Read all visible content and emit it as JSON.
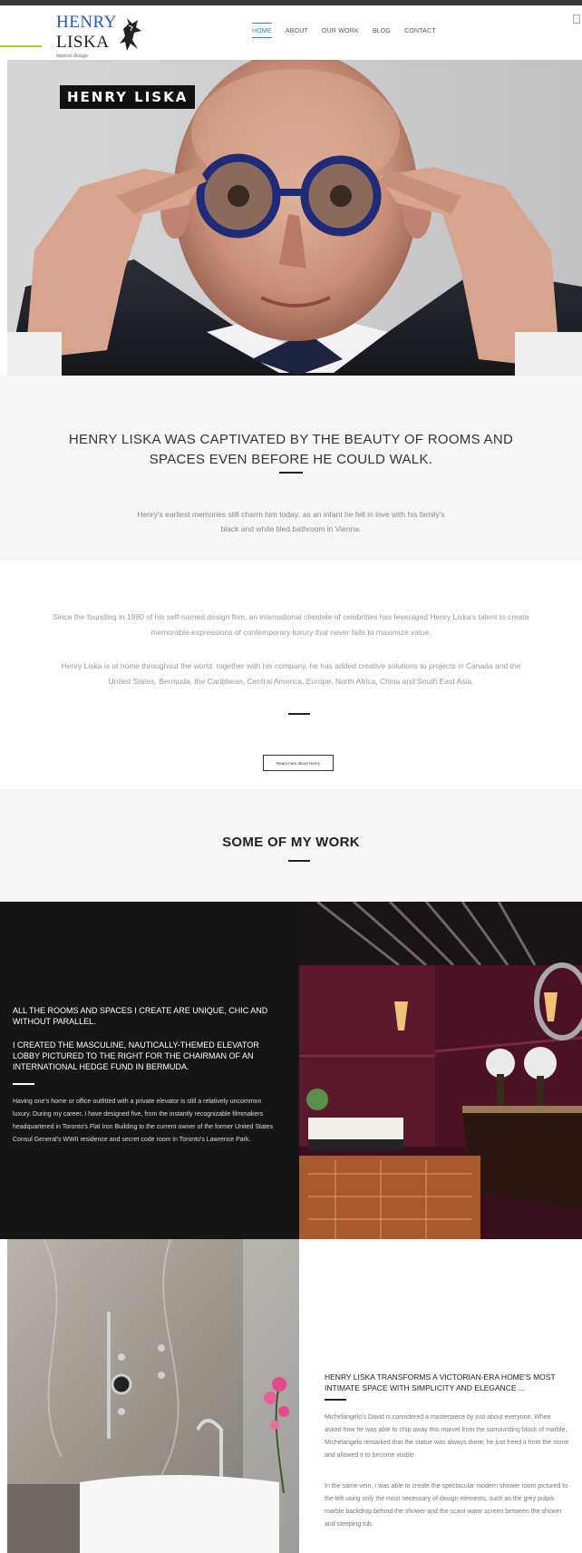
{
  "header": {
    "logo": {
      "line1": "HENRY",
      "line2": "LISKA",
      "sub": "interior design"
    },
    "nav": [
      "HOME",
      "ABOUT",
      "OUR WORK",
      "BLOG",
      "CONTACT"
    ],
    "active_nav": "HOME"
  },
  "hero": {
    "badge": "HENRY LISKA"
  },
  "intro": {
    "heading": "HENRY LISKA WAS CAPTIVATED BY THE BEAUTY OF ROOMS AND SPACES EVEN BEFORE HE COULD WALK.",
    "text": "Henry's earliest memories still charm him today: as an infant he fell in love with his family's black and white tiled bathroom in Vienna."
  },
  "about": {
    "p1": "Since the founding in 1980 of his self-named design firm, an international clientele of celebrities has leveraged Henry Liska's talent to create memorable expressions of contemporary luxury that never fails to maximize value.",
    "p2": "Henry Liska is at home throughout the world: together with his company, he has added creative solutions to projects in Canada and the United States, Bermuda, the Caribbean, Central America, Europe, North Africa, China and South East Asia.",
    "button": "Read more about Henry"
  },
  "work": {
    "title": "SOME OF MY WORK"
  },
  "elevator": {
    "heading1": "ALL THE ROOMS AND SPACES I CREATE ARE UNIQUE, CHIC AND WITHOUT PARALLEL.",
    "heading2": "I CREATED THE MASCULINE, NAUTICALLY-THEMED ELEVATOR LOBBY PICTURED TO THE RIGHT FOR THE CHAIRMAN OF AN INTERNATIONAL HEDGE FUND IN BERMUDA.",
    "text": "Having one's home or office outfitted with a private elevator is still a relatively uncommon luxury. During my career, I have designed five, from the instantly recognizable filmmakers headquartered in Toronto's Flat Iron Building to the current owner of the former United States Consul General's WWII residence and secret code room in Toronto's Lawrence Park."
  },
  "shower": {
    "heading": "HENRY LISKA TRANSFORMS A VICTORIAN-ERA HOME'S MOST INTIMATE SPACE WITH SIMPLICITY AND ELEGANCE ...",
    "p1": "Michelangelo's David is considered a masterpiece by just about everyone. When asked how he was able to chip away this marvel from the surrounding block of marble, Michelangelo remarked that the statue was always there; he just freed it from the stone and allowed it to become visible.",
    "p2": "In the same vein, I was able to create the spectacular modern shower room pictured to the left using only the most necessary of design elements, such as the grey pulpis marble backdrop behind the shower and the scant water screen between the shower and steeping tub."
  }
}
